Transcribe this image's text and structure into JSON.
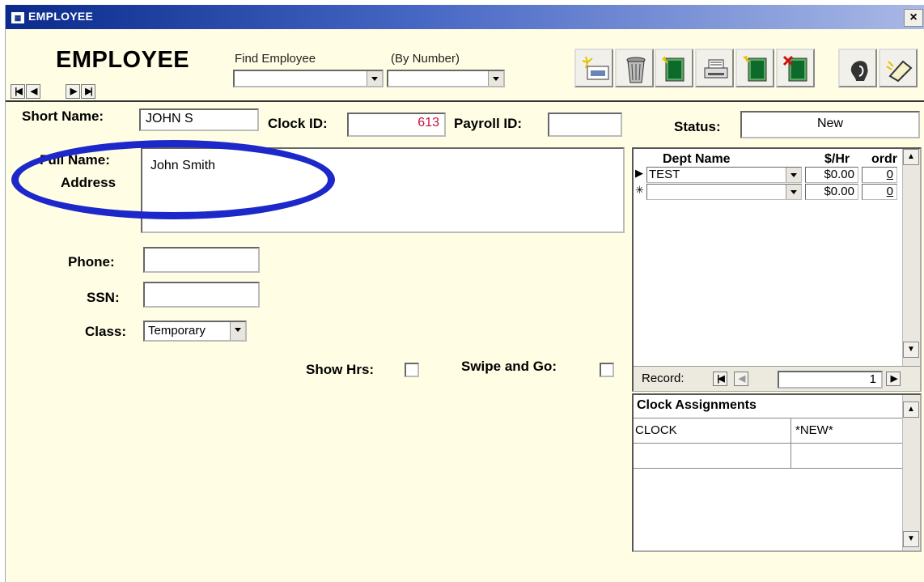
{
  "window": {
    "title": "EMPLOYEE",
    "close": "×"
  },
  "header": {
    "title": "EMPLOYEE",
    "find_label": "Find Employee",
    "by_number_label": "(By Number)",
    "find_value": "",
    "by_number_value": ""
  },
  "nav": {
    "first": "|◀",
    "prev": "◀",
    "next": "▶",
    "last": "▶|"
  },
  "toolbar": [
    {
      "name": "new-record-icon"
    },
    {
      "name": "trash-icon"
    },
    {
      "name": "printer-icon"
    },
    {
      "name": "add-book-icon"
    },
    {
      "name": "delete-book-icon"
    },
    {
      "name": "face-icon"
    },
    {
      "name": "eraser-icon"
    }
  ],
  "form": {
    "short_name_label": "Short Name:",
    "short_name": "JOHN S",
    "clock_id_label": "Clock ID:",
    "clock_id": "613",
    "payroll_id_label": "Payroll ID:",
    "payroll_id": "",
    "status_label": "Status:",
    "status": "New",
    "full_name_label": "Full Name:",
    "address_label": "Address",
    "full_name": "John Smith",
    "phone_label": "Phone:",
    "phone": "",
    "ssn_label": "SSN:",
    "ssn": "",
    "class_label": "Class:",
    "class": "Temporary",
    "show_hrs_label": "Show Hrs:",
    "swipe_label": "Swipe and Go:"
  },
  "dept_grid": {
    "headers": [
      "Dept Name",
      "$/Hr",
      "ordr"
    ],
    "rows": [
      {
        "marker": "▶",
        "dept": "TEST",
        "rate": "$0.00",
        "ordr": "0"
      },
      {
        "marker": "✳",
        "dept": "",
        "rate": "$0.00",
        "ordr": "0"
      }
    ],
    "record_label": "Record:",
    "record_value": "1"
  },
  "clock_grid": {
    "header": "Clock Assignments",
    "rows": [
      {
        "clock": "CLOCK",
        "value": "*NEW*"
      },
      {
        "clock": "",
        "value": ""
      }
    ]
  },
  "colors": {
    "accent": "#1c28c9",
    "background": "#fffde3",
    "title_bar": "#0a2a8c",
    "clock_id_text": "#c8103c"
  }
}
